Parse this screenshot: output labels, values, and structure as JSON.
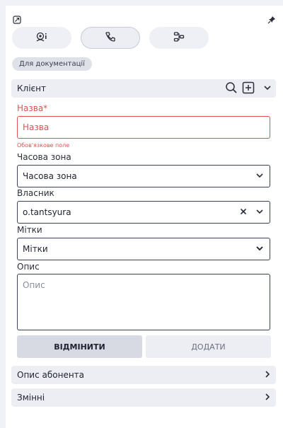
{
  "tag": {
    "label": "Для документації"
  },
  "client_section": {
    "title": "Клієнт"
  },
  "form": {
    "name": {
      "label": "Назва*",
      "placeholder": "Назва",
      "error": "Обов'язкове поле"
    },
    "timezone": {
      "label": "Часова зона",
      "value": "Часова зона"
    },
    "owner": {
      "label": "Власник",
      "value": "o.tantsyura"
    },
    "tags": {
      "label": "Мітки",
      "value": "Мітки"
    },
    "description": {
      "label": "Опис",
      "placeholder": "Опис"
    }
  },
  "buttons": {
    "cancel": "ВІДМІНИТИ",
    "add": "ДОДАТИ"
  },
  "sections": [
    {
      "title": "Опис абонента"
    },
    {
      "title": "Змінні"
    }
  ],
  "colors": {
    "error": "#e0524f",
    "border": "#3c4059",
    "panel_bg": "#ffffff",
    "page_bg": "#f1f2f7"
  },
  "icons": [
    "expand-icon",
    "pin-icon",
    "agent-icon",
    "phone-icon",
    "flow-icon",
    "search-icon",
    "add-box-icon",
    "chevron-down-icon",
    "clear-icon",
    "chevron-right-icon"
  ]
}
